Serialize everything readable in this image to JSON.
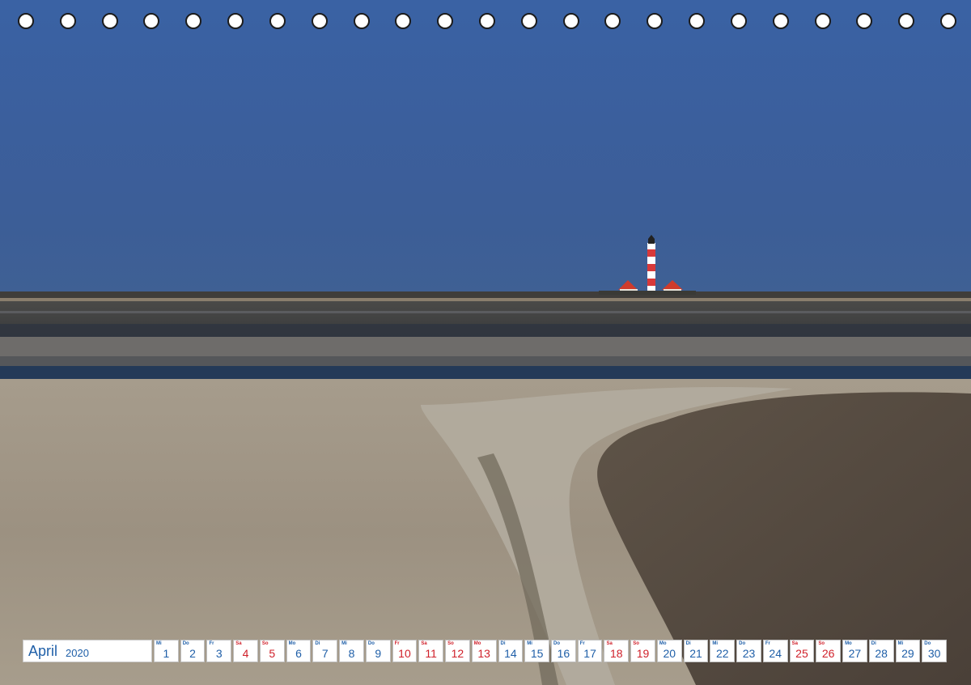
{
  "calendar": {
    "month": "April",
    "year": "2020",
    "days": [
      {
        "wd": "Mi",
        "num": "1",
        "weekend": false
      },
      {
        "wd": "Do",
        "num": "2",
        "weekend": false
      },
      {
        "wd": "Fr",
        "num": "3",
        "weekend": false
      },
      {
        "wd": "Sa",
        "num": "4",
        "weekend": true
      },
      {
        "wd": "So",
        "num": "5",
        "weekend": true
      },
      {
        "wd": "Mo",
        "num": "6",
        "weekend": false
      },
      {
        "wd": "Di",
        "num": "7",
        "weekend": false
      },
      {
        "wd": "Mi",
        "num": "8",
        "weekend": false
      },
      {
        "wd": "Do",
        "num": "9",
        "weekend": false
      },
      {
        "wd": "Fr",
        "num": "10",
        "weekend": true
      },
      {
        "wd": "Sa",
        "num": "11",
        "weekend": true
      },
      {
        "wd": "So",
        "num": "12",
        "weekend": true
      },
      {
        "wd": "Mo",
        "num": "13",
        "weekend": true
      },
      {
        "wd": "Di",
        "num": "14",
        "weekend": false
      },
      {
        "wd": "Mi",
        "num": "15",
        "weekend": false
      },
      {
        "wd": "Do",
        "num": "16",
        "weekend": false
      },
      {
        "wd": "Fr",
        "num": "17",
        "weekend": false
      },
      {
        "wd": "Sa",
        "num": "18",
        "weekend": true
      },
      {
        "wd": "So",
        "num": "19",
        "weekend": true
      },
      {
        "wd": "Mo",
        "num": "20",
        "weekend": false
      },
      {
        "wd": "Di",
        "num": "21",
        "weekend": false
      },
      {
        "wd": "Mi",
        "num": "22",
        "weekend": false
      },
      {
        "wd": "Do",
        "num": "23",
        "weekend": false
      },
      {
        "wd": "Fr",
        "num": "24",
        "weekend": false
      },
      {
        "wd": "Sa",
        "num": "25",
        "weekend": true
      },
      {
        "wd": "So",
        "num": "26",
        "weekend": true
      },
      {
        "wd": "Mo",
        "num": "27",
        "weekend": false
      },
      {
        "wd": "Di",
        "num": "28",
        "weekend": false
      },
      {
        "wd": "Mi",
        "num": "29",
        "weekend": false
      },
      {
        "wd": "Do",
        "num": "30",
        "weekend": false
      }
    ]
  },
  "colors": {
    "weekday_text": "#1f5fa8",
    "weekend_text": "#d0202a",
    "sky": "#3b5f9d",
    "lighthouse_red": "#d8393a"
  },
  "punch_holes": {
    "count": 23
  }
}
